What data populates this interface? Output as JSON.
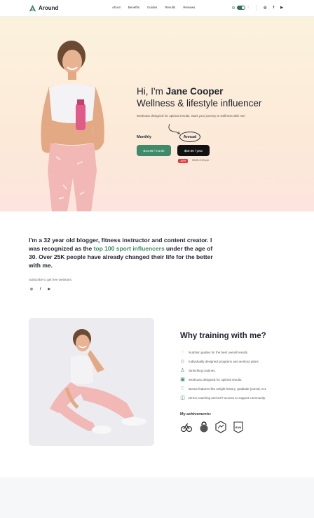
{
  "brand": {
    "name": "Around",
    "color": "#3f8a68"
  },
  "nav": {
    "items": [
      "About",
      "Benefits",
      "Guides",
      "Results",
      "Reviews"
    ],
    "social": [
      "ig",
      "f",
      "yt"
    ]
  },
  "hero": {
    "greeting": "Hi, I'm ",
    "name": "Jane Cooper",
    "headline": "Wellness & lifestyle influencer",
    "subtitle": "Workouts designed for optimal results. Start your journey to wellness with me!",
    "plan_monthly": "Monthly",
    "plan_annual": "Annual",
    "price_monthly": "$14.99 / month",
    "price_annual": "$69.99 / year",
    "badge": "-50%",
    "timer": "09:55 8:00 pm"
  },
  "about": {
    "text_before": "I'm a 32 year old blogger, fitness instructor and content creator. I was recognized as the ",
    "highlight": "top 100 sport influencers",
    "text_after": " under the age of 30. Over 25K people have already changed their life for the better with me.",
    "subscribe": "Subscribe to get free webinars:",
    "social": [
      "ig",
      "f",
      "yt"
    ]
  },
  "training": {
    "title": "Why training with me?",
    "features": [
      "Nutrition guides for the best overall results.",
      "Individually designed programs and workout plans.",
      "Stretching routines.",
      "Workouts designed for optimal results.",
      "Bonus features like weight history, gratitude journal, ect.",
      "Direct coaching and 24/7 access to support community."
    ],
    "achievements_title": "My achivements:",
    "achievements": [
      "badge-bike-icon",
      "kettlebell-icon",
      "trail-badge-icon",
      "run-badge-icon"
    ],
    "run_label": "RUN"
  },
  "colors": {
    "accent": "#3f8a68",
    "dark": "#111111",
    "sale": "#e23b3b"
  }
}
